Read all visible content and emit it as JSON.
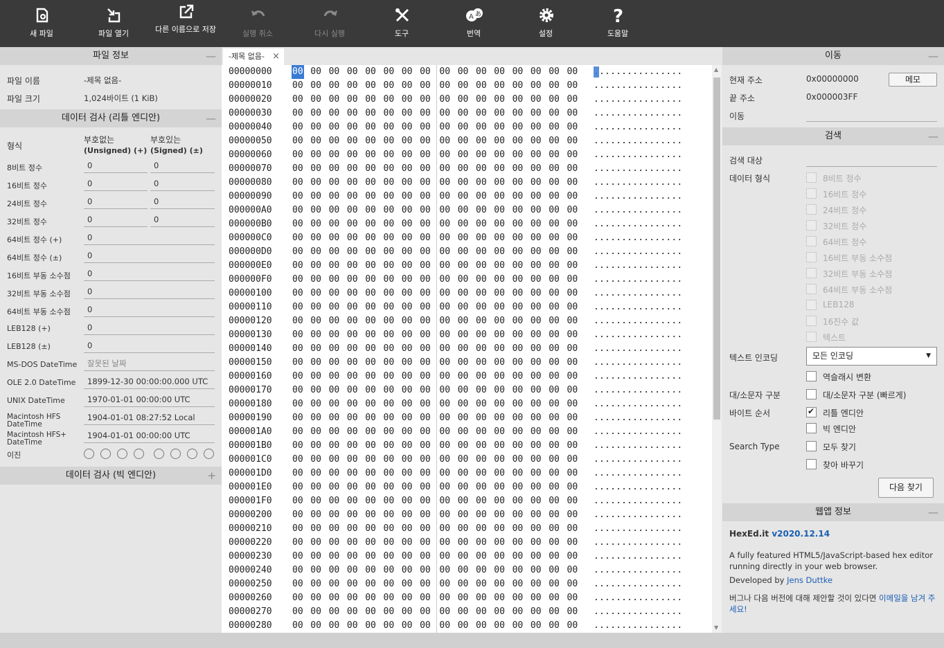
{
  "toolbar": {
    "new": "새 파일",
    "open": "파일 열기",
    "save_as": "다른 이름으로 저장",
    "undo": "실행 취소",
    "redo": "다시 실행",
    "tools": "도구",
    "translate": "번역",
    "settings": "설정",
    "help": "도움말"
  },
  "file_info": {
    "title": "파일 정보",
    "toggle": "—",
    "name_label": "파일 이름",
    "name_value": "-제목 없음-",
    "size_label": "파일 크기",
    "size_value": "1,024바이트 (1 KiB)"
  },
  "inspector": {
    "title": "데이터 검사 (리틀 엔디안)",
    "toggle": "—",
    "col_format": "형식",
    "col_unsigned_1": "부호없는",
    "col_unsigned_2": "(Unsigned) (+)",
    "col_signed_1": "부호있는",
    "col_signed_2": "(Signed) (±)",
    "rows": [
      {
        "label": "8비트 정수",
        "u": "0",
        "s": "0"
      },
      {
        "label": "16비트 정수",
        "u": "0",
        "s": "0"
      },
      {
        "label": "24비트 정수",
        "u": "0",
        "s": "0"
      },
      {
        "label": "32비트 정수",
        "u": "0",
        "s": "0"
      },
      {
        "label": "64비트 정수 (+)",
        "v": "0"
      },
      {
        "label": "64비트 정수 (±)",
        "v": "0"
      },
      {
        "label": "16비트 부동 소수점",
        "v": "0"
      },
      {
        "label": "32비트 부동 소수점",
        "v": "0"
      },
      {
        "label": "64비트 부동 소수점",
        "v": "0"
      },
      {
        "label": "LEB128 (+)",
        "v": "0"
      },
      {
        "label": "LEB128 (±)",
        "v": "0"
      },
      {
        "label": "MS-DOS DateTime",
        "v": "잘못된 날짜"
      },
      {
        "label": "OLE 2.0 DateTime",
        "v": "1899-12-30 00:00:00.000 UTC"
      },
      {
        "label": "UNIX DateTime",
        "v": "1970-01-01 00:00:00 UTC"
      },
      {
        "label": "Macintosh HFS DateTime",
        "v": "1904-01-01 08:27:52 Local"
      },
      {
        "label": "Macintosh HFS+ DateTime",
        "v": "1904-01-01 00:00:00 UTC"
      }
    ],
    "binary_label": "이진"
  },
  "inspector_be": {
    "title": "데이터 검사 (빅 엔디안)",
    "toggle": "+"
  },
  "tab": {
    "label": "-제목 없음-",
    "close": "×"
  },
  "hex": {
    "byte": "00",
    "ascii": "................",
    "addresses": [
      "00000000",
      "00000010",
      "00000020",
      "00000030",
      "00000040",
      "00000050",
      "00000060",
      "00000070",
      "00000080",
      "00000090",
      "000000A0",
      "000000B0",
      "000000C0",
      "000000D0",
      "000000E0",
      "000000F0",
      "00000100",
      "00000110",
      "00000120",
      "00000130",
      "00000140",
      "00000150",
      "00000160",
      "00000170",
      "00000180",
      "00000190",
      "000001A0",
      "000001B0",
      "000001C0",
      "000001D0",
      "000001E0",
      "000001F0",
      "00000200",
      "00000210",
      "00000220",
      "00000230",
      "00000240",
      "00000250",
      "00000260",
      "00000270",
      "00000280"
    ]
  },
  "goto": {
    "title": "이동",
    "toggle": "—",
    "current_label": "현재 주소",
    "current_value": "0x00000000",
    "memo_button": "메모",
    "end_label": "끝 주소",
    "end_value": "0x000003FF",
    "goto_label": "이동"
  },
  "search": {
    "title": "검색",
    "toggle": "—",
    "target_label": "검색 대상",
    "format_label": "데이터 형식",
    "formats": [
      "8비트 정수",
      "16비트 정수",
      "24비트 정수",
      "32비트 정수",
      "64비트 정수",
      "16비트 부동 소수점",
      "32비트 부동 소수점",
      "64비트 부동 소수점",
      "LEB128",
      "16진수 값",
      "텍스트"
    ],
    "encoding_label": "텍스트 인코딩",
    "encoding_value": "모든 인코딩",
    "backslash_label": "역슬래시 변환",
    "case_label": "대/소문자 구분",
    "case_option": "대/소문자 구분 (빠르게)",
    "byteorder_label": "바이트 순서",
    "little_endian": "리틀 엔디안",
    "big_endian": "빅 엔디안",
    "search_type_label": "Search Type",
    "find_all": "모두 찾기",
    "replace": "찾아 바꾸기",
    "next_button": "다음 찾기"
  },
  "about": {
    "title": "웹앱 정보",
    "toggle": "—",
    "app_name": "HexEd.it",
    "version": "v2020.12.14",
    "desc": "A fully featured HTML5/JavaScript-based hex editor running directly in your web browser.",
    "developed_by": "Developed by",
    "author": "Jens Duttke",
    "suggest": "버그나 다음 버전에 대해 제안할 것이 있다면",
    "email_link": "이메일을 남겨 주세요!"
  }
}
